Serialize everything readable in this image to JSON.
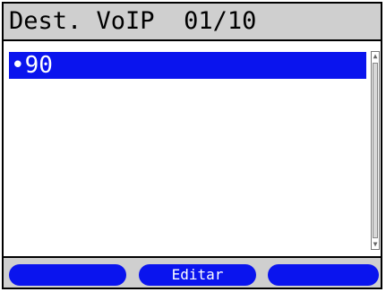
{
  "title": "Dest. VoIP  01/10",
  "list": {
    "items": [
      {
        "label": "•90",
        "selected": true
      }
    ]
  },
  "scrollbar": {
    "up_glyph": "▲",
    "down_glyph": "▼"
  },
  "softkeys": {
    "f1": "",
    "f2": "Editar",
    "f3": ""
  },
  "colors": {
    "accent": "#0a14ee",
    "bar": "#cfcfcf",
    "text": "#000000",
    "background": "#ffffff"
  }
}
